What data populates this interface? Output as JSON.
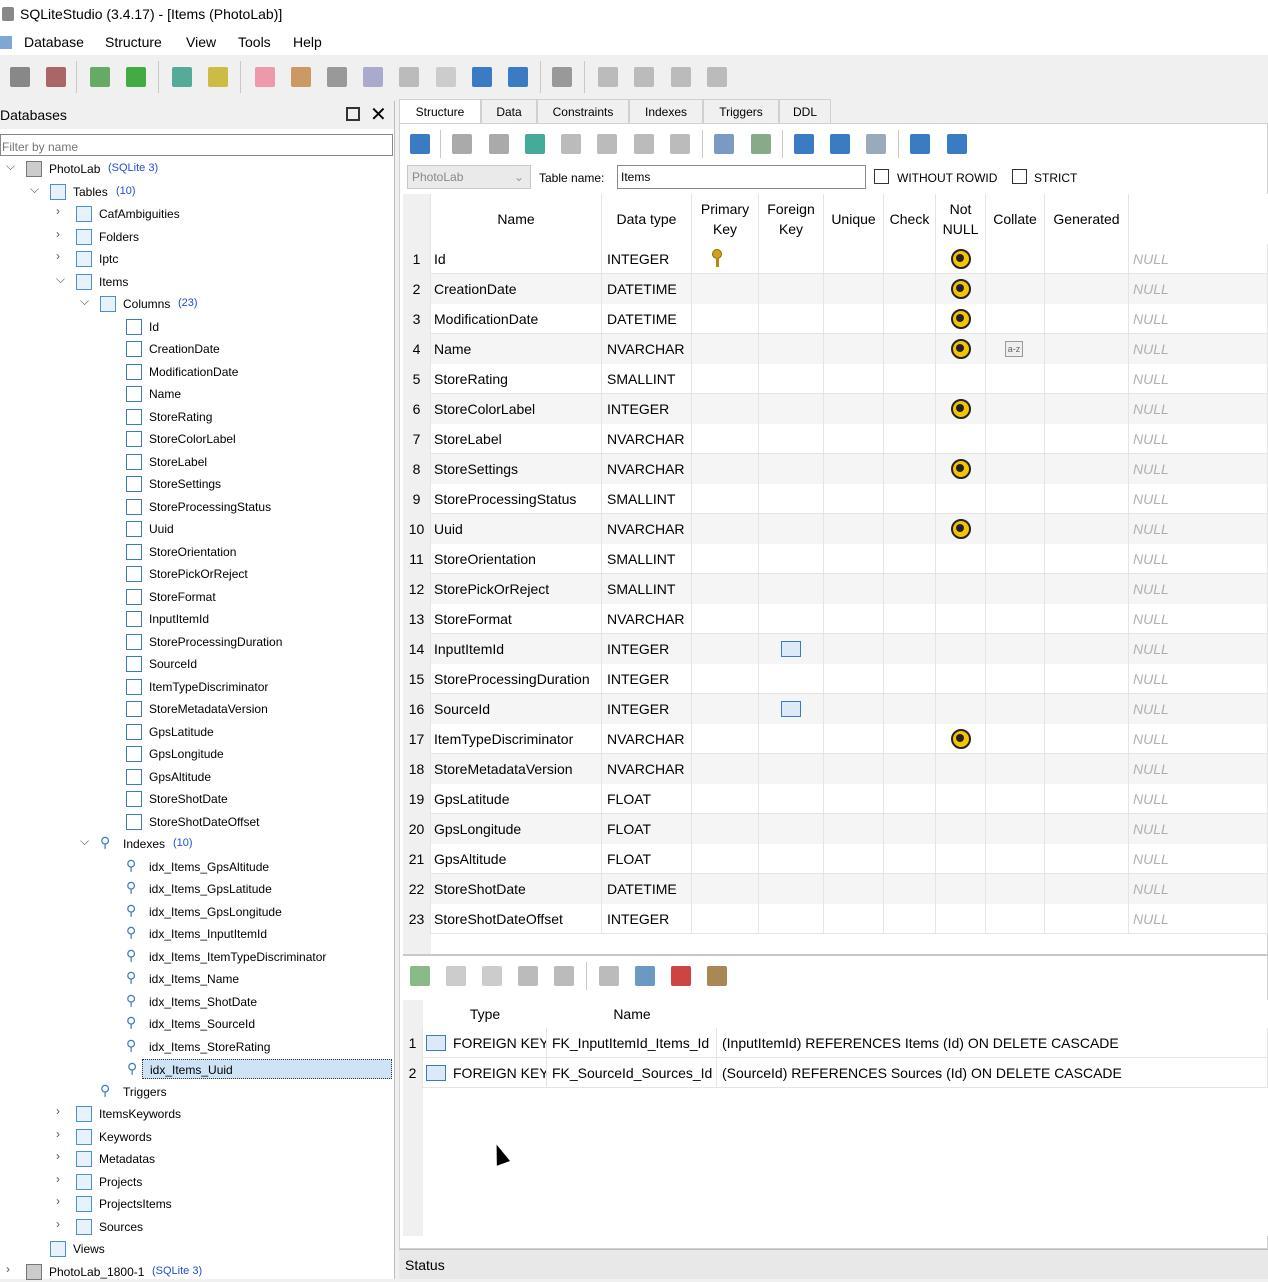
{
  "window": {
    "title": "SQLiteStudio (3.4.17) - [Items (PhotoLab)]"
  },
  "menu": [
    "Database",
    "Structure",
    "View",
    "Tools",
    "Help"
  ],
  "db_panel": {
    "title": "Databases",
    "filter_placeholder": "Filter by name",
    "tree": {
      "db1": {
        "name": "PhotoLab",
        "type": "(SQLite 3)"
      },
      "tables_label": "Tables",
      "tables_count": "(10)",
      "tables_before": [
        "CafAmbiguities",
        "Folders",
        "Iptc"
      ],
      "items_table": "Items",
      "columns_label": "Columns",
      "columns_count": "(23)",
      "columns": [
        "Id",
        "CreationDate",
        "ModificationDate",
        "Name",
        "StoreRating",
        "StoreColorLabel",
        "StoreLabel",
        "StoreSettings",
        "StoreProcessingStatus",
        "Uuid",
        "StoreOrientation",
        "StorePickOrReject",
        "StoreFormat",
        "InputItemId",
        "StoreProcessingDuration",
        "SourceId",
        "ItemTypeDiscriminator",
        "StoreMetadataVersion",
        "GpsLatitude",
        "GpsLongitude",
        "GpsAltitude",
        "StoreShotDate",
        "StoreShotDateOffset"
      ],
      "indexes_label": "Indexes",
      "indexes_count": "(10)",
      "indexes": [
        "idx_Items_GpsAltitude",
        "idx_Items_GpsLatitude",
        "idx_Items_GpsLongitude",
        "idx_Items_InputItemId",
        "idx_Items_ItemTypeDiscriminator",
        "idx_Items_Name",
        "idx_Items_ShotDate",
        "idx_Items_SourceId",
        "idx_Items_StoreRating",
        "idx_Items_Uuid"
      ],
      "triggers_label": "Triggers",
      "tables_after": [
        "ItemsKeywords",
        "Keywords",
        "Metadatas",
        "Projects",
        "ProjectsItems",
        "Sources"
      ],
      "views_label": "Views",
      "db2": {
        "name": "PhotoLab_1800-1",
        "type": "(SQLite 3)"
      }
    }
  },
  "tabs": [
    "Structure",
    "Data",
    "Constraints",
    "Indexes",
    "Triggers",
    "DDL"
  ],
  "active_tab": "Structure",
  "table_form": {
    "database": "PhotoLab",
    "table_name_label": "Table name:",
    "table_name": "Items",
    "without_rowid_label": "WITHOUT ROWID",
    "strict_label": "STRICT"
  },
  "grid_headers": {
    "name": "Name",
    "datatype": "Data type",
    "pk_1": "Primary",
    "pk_2": "Key",
    "fk_1": "Foreign",
    "fk_2": "Key",
    "unique": "Unique",
    "check": "Check",
    "nn_1": "Not",
    "nn_2": "NULL",
    "collate": "Collate",
    "generated": "Generated"
  },
  "columns": [
    {
      "n": "1",
      "name": "Id",
      "type": "INTEGER",
      "pk": true,
      "fk": false,
      "nn": true,
      "collate": false,
      "default": "NULL"
    },
    {
      "n": "2",
      "name": "CreationDate",
      "type": "DATETIME",
      "pk": false,
      "fk": false,
      "nn": true,
      "collate": false,
      "default": "NULL"
    },
    {
      "n": "3",
      "name": "ModificationDate",
      "type": "DATETIME",
      "pk": false,
      "fk": false,
      "nn": true,
      "collate": false,
      "default": "NULL"
    },
    {
      "n": "4",
      "name": "Name",
      "type": "NVARCHAR",
      "pk": false,
      "fk": false,
      "nn": true,
      "collate": true,
      "default": "NULL"
    },
    {
      "n": "5",
      "name": "StoreRating",
      "type": "SMALLINT",
      "pk": false,
      "fk": false,
      "nn": false,
      "collate": false,
      "default": "NULL"
    },
    {
      "n": "6",
      "name": "StoreColorLabel",
      "type": "INTEGER",
      "pk": false,
      "fk": false,
      "nn": true,
      "collate": false,
      "default": "NULL"
    },
    {
      "n": "7",
      "name": "StoreLabel",
      "type": "NVARCHAR",
      "pk": false,
      "fk": false,
      "nn": false,
      "collate": false,
      "default": "NULL"
    },
    {
      "n": "8",
      "name": "StoreSettings",
      "type": "NVARCHAR",
      "pk": false,
      "fk": false,
      "nn": true,
      "collate": false,
      "default": "NULL"
    },
    {
      "n": "9",
      "name": "StoreProcessingStatus",
      "type": "SMALLINT",
      "pk": false,
      "fk": false,
      "nn": false,
      "collate": false,
      "default": "NULL"
    },
    {
      "n": "10",
      "name": "Uuid",
      "type": "NVARCHAR",
      "pk": false,
      "fk": false,
      "nn": true,
      "collate": false,
      "default": "NULL"
    },
    {
      "n": "11",
      "name": "StoreOrientation",
      "type": "SMALLINT",
      "pk": false,
      "fk": false,
      "nn": false,
      "collate": false,
      "default": "NULL"
    },
    {
      "n": "12",
      "name": "StorePickOrReject",
      "type": "SMALLINT",
      "pk": false,
      "fk": false,
      "nn": false,
      "collate": false,
      "default": "NULL"
    },
    {
      "n": "13",
      "name": "StoreFormat",
      "type": "NVARCHAR",
      "pk": false,
      "fk": false,
      "nn": false,
      "collate": false,
      "default": "NULL"
    },
    {
      "n": "14",
      "name": "InputItemId",
      "type": "INTEGER",
      "pk": false,
      "fk": true,
      "nn": false,
      "collate": false,
      "default": "NULL"
    },
    {
      "n": "15",
      "name": "StoreProcessingDuration",
      "type": "INTEGER",
      "pk": false,
      "fk": false,
      "nn": false,
      "collate": false,
      "default": "NULL"
    },
    {
      "n": "16",
      "name": "SourceId",
      "type": "INTEGER",
      "pk": false,
      "fk": true,
      "nn": false,
      "collate": false,
      "default": "NULL"
    },
    {
      "n": "17",
      "name": "ItemTypeDiscriminator",
      "type": "NVARCHAR",
      "pk": false,
      "fk": false,
      "nn": true,
      "collate": false,
      "default": "NULL"
    },
    {
      "n": "18",
      "name": "StoreMetadataVersion",
      "type": "NVARCHAR",
      "pk": false,
      "fk": false,
      "nn": false,
      "collate": false,
      "default": "NULL"
    },
    {
      "n": "19",
      "name": "GpsLatitude",
      "type": "FLOAT",
      "pk": false,
      "fk": false,
      "nn": false,
      "collate": false,
      "default": "NULL"
    },
    {
      "n": "20",
      "name": "GpsLongitude",
      "type": "FLOAT",
      "pk": false,
      "fk": false,
      "nn": false,
      "collate": false,
      "default": "NULL"
    },
    {
      "n": "21",
      "name": "GpsAltitude",
      "type": "FLOAT",
      "pk": false,
      "fk": false,
      "nn": false,
      "collate": false,
      "default": "NULL"
    },
    {
      "n": "22",
      "name": "StoreShotDate",
      "type": "DATETIME",
      "pk": false,
      "fk": false,
      "nn": false,
      "collate": false,
      "default": "NULL"
    },
    {
      "n": "23",
      "name": "StoreShotDateOffset",
      "type": "INTEGER",
      "pk": false,
      "fk": false,
      "nn": false,
      "collate": false,
      "default": "NULL"
    }
  ],
  "collate_icon_text": "a-z",
  "constraints_headers": {
    "type": "Type",
    "name": "Name"
  },
  "constraints": [
    {
      "n": "1",
      "type": "FOREIGN KEY",
      "name": "FK_InputItemId_Items_Id",
      "details": "(InputItemId) REFERENCES Items (Id) ON DELETE CASCADE"
    },
    {
      "n": "2",
      "type": "FOREIGN KEY",
      "name": "FK_SourceId_Sources_Id",
      "details": "(SourceId) REFERENCES Sources (Id) ON DELETE CASCADE"
    }
  ],
  "status": "Status",
  "colors": {
    "accent": "#3a7bc4",
    "tree_count": "#1f4fd1",
    "null_text": "#b0b0b0",
    "not_null_icon": "#f5c400"
  }
}
